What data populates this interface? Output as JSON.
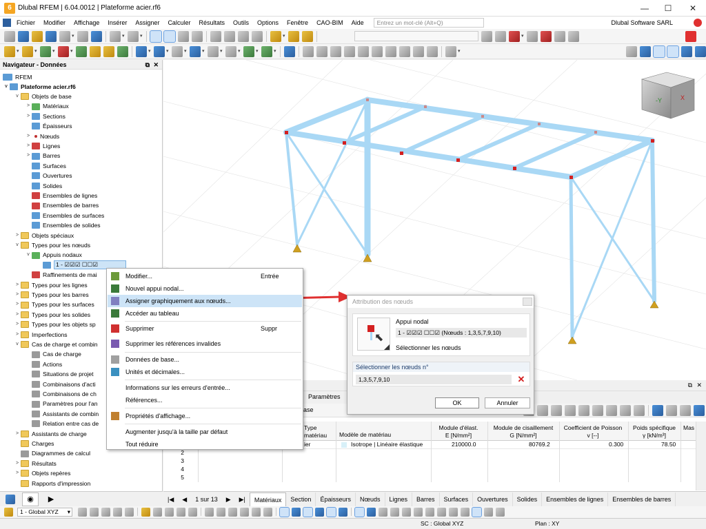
{
  "window": {
    "title": "Dlubal RFEM | 6.04.0012 | Plateforme acier.rf6",
    "app_icon_letter": "6"
  },
  "menu": {
    "items": [
      "Fichier",
      "Modifier",
      "Affichage",
      "Insérer",
      "Assigner",
      "Calculer",
      "Résultats",
      "Outils",
      "Options",
      "Fenêtre",
      "CAO-BIM",
      "Aide"
    ],
    "search_placeholder": "Entrez un mot-clé (Alt+Q)",
    "company": "Dlubal Software SARL"
  },
  "navigator": {
    "title": "Navigateur - Données",
    "root": "RFEM",
    "model": "Plateforme acier.rf6",
    "items": [
      {
        "label": "Objets de base",
        "level": 1,
        "icon": "folder-icon",
        "arrow": "v"
      },
      {
        "label": "Matériaux",
        "level": 2,
        "icon": "materials-icon",
        "arrow": ">"
      },
      {
        "label": "Sections",
        "level": 2,
        "icon": "sections-icon",
        "arrow": ">"
      },
      {
        "label": "Épaisseurs",
        "level": 2,
        "icon": "thickness-icon",
        "arrow": ""
      },
      {
        "label": "Nœuds",
        "level": 2,
        "icon": "node-icon",
        "arrow": ">"
      },
      {
        "label": "Lignes",
        "level": 2,
        "icon": "line-icon",
        "arrow": ">"
      },
      {
        "label": "Barres",
        "level": 2,
        "icon": "member-icon",
        "arrow": ">"
      },
      {
        "label": "Surfaces",
        "level": 2,
        "icon": "surface-icon",
        "arrow": ""
      },
      {
        "label": "Ouvertures",
        "level": 2,
        "icon": "opening-icon",
        "arrow": ""
      },
      {
        "label": "Solides",
        "level": 2,
        "icon": "solid-icon",
        "arrow": ""
      },
      {
        "label": "Ensembles de lignes",
        "level": 2,
        "icon": "line-set-icon",
        "arrow": ""
      },
      {
        "label": "Ensembles de barres",
        "level": 2,
        "icon": "member-set-icon",
        "arrow": ""
      },
      {
        "label": "Ensembles de surfaces",
        "level": 2,
        "icon": "surface-set-icon",
        "arrow": ""
      },
      {
        "label": "Ensembles de solides",
        "level": 2,
        "icon": "solid-set-icon",
        "arrow": ""
      },
      {
        "label": "Objets spéciaux",
        "level": 1,
        "icon": "folder-icon",
        "arrow": ">"
      },
      {
        "label": "Types pour les nœuds",
        "level": 1,
        "icon": "folder-icon",
        "arrow": "v"
      },
      {
        "label": "Appuis nodaux",
        "level": 2,
        "icon": "nodal-support-icon",
        "arrow": "v"
      },
      {
        "label": "1 - ☑☑☑ ☐☐☑",
        "level": 3,
        "icon": "support-item-icon",
        "arrow": "",
        "selected": true
      },
      {
        "label": "Raffinements de mai",
        "level": 2,
        "icon": "mesh-refinement-icon",
        "arrow": ""
      },
      {
        "label": "Types pour les lignes",
        "level": 1,
        "icon": "folder-icon",
        "arrow": ">"
      },
      {
        "label": "Types pour les barres",
        "level": 1,
        "icon": "folder-icon",
        "arrow": ">"
      },
      {
        "label": "Types pour les surfaces",
        "level": 1,
        "icon": "folder-icon",
        "arrow": ">"
      },
      {
        "label": "Types pour les solides",
        "level": 1,
        "icon": "folder-icon",
        "arrow": ">"
      },
      {
        "label": "Types pour les objets sp",
        "level": 1,
        "icon": "folder-icon",
        "arrow": ">"
      },
      {
        "label": "Imperfections",
        "level": 1,
        "icon": "folder-icon",
        "arrow": ">"
      },
      {
        "label": "Cas de charge et combin",
        "level": 1,
        "icon": "folder-icon",
        "arrow": "v"
      },
      {
        "label": "Cas de charge",
        "level": 2,
        "icon": "load-case-icon",
        "arrow": ""
      },
      {
        "label": "Actions",
        "level": 2,
        "icon": "actions-icon",
        "arrow": ""
      },
      {
        "label": "Situations de projet",
        "level": 2,
        "icon": "design-situation-icon",
        "arrow": ""
      },
      {
        "label": "Combinaisons d'acti",
        "level": 2,
        "icon": "action-combination-icon",
        "arrow": ""
      },
      {
        "label": "Combinaisons de ch",
        "level": 2,
        "icon": "load-combination-icon",
        "arrow": ""
      },
      {
        "label": "Paramètres pour l'an",
        "level": 2,
        "icon": "analysis-settings-icon",
        "arrow": ""
      },
      {
        "label": "Assistants de combin",
        "level": 2,
        "icon": "combination-wizard-icon",
        "arrow": ""
      },
      {
        "label": "Relation entre cas de",
        "level": 2,
        "icon": "relation-icon",
        "arrow": ""
      },
      {
        "label": "Assistants de charge",
        "level": 1,
        "icon": "folder-icon",
        "arrow": ">"
      },
      {
        "label": "Charges",
        "level": 1,
        "icon": "folder-icon",
        "arrow": ""
      },
      {
        "label": "Diagrammes de calcul",
        "level": 1,
        "icon": "calc-diagram-icon",
        "arrow": ""
      },
      {
        "label": "Résultats",
        "level": 1,
        "icon": "folder-icon",
        "arrow": ">"
      },
      {
        "label": "Objets repères",
        "level": 1,
        "icon": "folder-icon",
        "arrow": ">"
      },
      {
        "label": "Rapports d'impression",
        "level": 1,
        "icon": "folder-icon",
        "arrow": ""
      }
    ]
  },
  "context_menu": {
    "items": [
      {
        "label": "Modifier...",
        "shortcut": "Entrée",
        "icon": "edit-icon"
      },
      {
        "label": "Nouvel appui nodal...",
        "shortcut": "",
        "icon": "new-support-icon"
      },
      {
        "label": "Assigner graphiquement aux nœuds...",
        "shortcut": "",
        "icon": "assign-icon",
        "highlighted": true
      },
      {
        "label": "Accéder au tableau",
        "shortcut": "",
        "icon": "table-icon"
      },
      {
        "label": "Supprimer",
        "shortcut": "Suppr",
        "icon": "delete-icon"
      },
      {
        "label": "Supprimer les références invalides",
        "shortcut": "",
        "icon": "delete-refs-icon"
      },
      {
        "label": "Données de base...",
        "shortcut": "",
        "icon": "base-data-icon"
      },
      {
        "label": "Unités et décimales...",
        "shortcut": "",
        "icon": "units-icon"
      },
      {
        "label": "Informations sur les erreurs d'entrée...",
        "shortcut": "",
        "icon": ""
      },
      {
        "label": "Références...",
        "shortcut": "",
        "icon": ""
      },
      {
        "label": "Propriétés d'affichage...",
        "shortcut": "",
        "icon": "display-props-icon"
      },
      {
        "label": "Augmenter jusqu'à la taille par défaut",
        "shortcut": "",
        "icon": ""
      },
      {
        "label": "Tout réduire",
        "shortcut": "",
        "icon": ""
      }
    ]
  },
  "dialog": {
    "title": "Attribution des nœuds",
    "support_label": "Appui nodal",
    "support_value": "1 - ☑☑☑ ☐☐☑ (Nœuds : 1,3,5,7,9,10)",
    "select_nodes_label": "Sélectionner les nœuds",
    "section_label": "Sélectionner les nœuds n°",
    "nodes_value": "1,3,5,7,9,10",
    "ok": "OK",
    "cancel": "Annuler"
  },
  "table": {
    "left_tabs": [
      "Paramètres"
    ],
    "base_label": "base",
    "headers": [
      {
        "l1": "Type",
        "l2": "matériau"
      },
      {
        "l1": "Modèle de matériau",
        "l2": ""
      },
      {
        "l1": "Module d'élast.",
        "l2": "E [N/mm²]"
      },
      {
        "l1": "Module de cisaillement",
        "l2": "G [N/mm²]"
      },
      {
        "l1": "Coefficient de Poisson",
        "l2": "v [--]"
      },
      {
        "l1": "Poids spécifique",
        "l2": "γ [kN/m³]"
      },
      {
        "l1": "Mas",
        "l2": ""
      }
    ],
    "row1": {
      "type": "ier",
      "model": "Isotrope | Linéaire élastique",
      "E": "210000.0",
      "G": "80769.2",
      "nu": "0.300",
      "gamma": "78.50"
    },
    "row_numbers": [
      "2",
      "3",
      "4",
      "5"
    ],
    "pager": "1 sur 13",
    "tabs": [
      "Matériaux",
      "Section",
      "Épaisseurs",
      "Nœuds",
      "Lignes",
      "Barres",
      "Surfaces",
      "Ouvertures",
      "Solides",
      "Ensembles de lignes",
      "Ensembles de barres"
    ]
  },
  "status": {
    "combo": "1 - Global XYZ",
    "sc": "SC : Global XYZ",
    "plan": "Plan : XY"
  },
  "colors": {
    "accent": "#3d8ee0",
    "member": "#a9d8f5",
    "node": "#d42020",
    "support": "#d0a020",
    "arrow": "#e03030"
  }
}
